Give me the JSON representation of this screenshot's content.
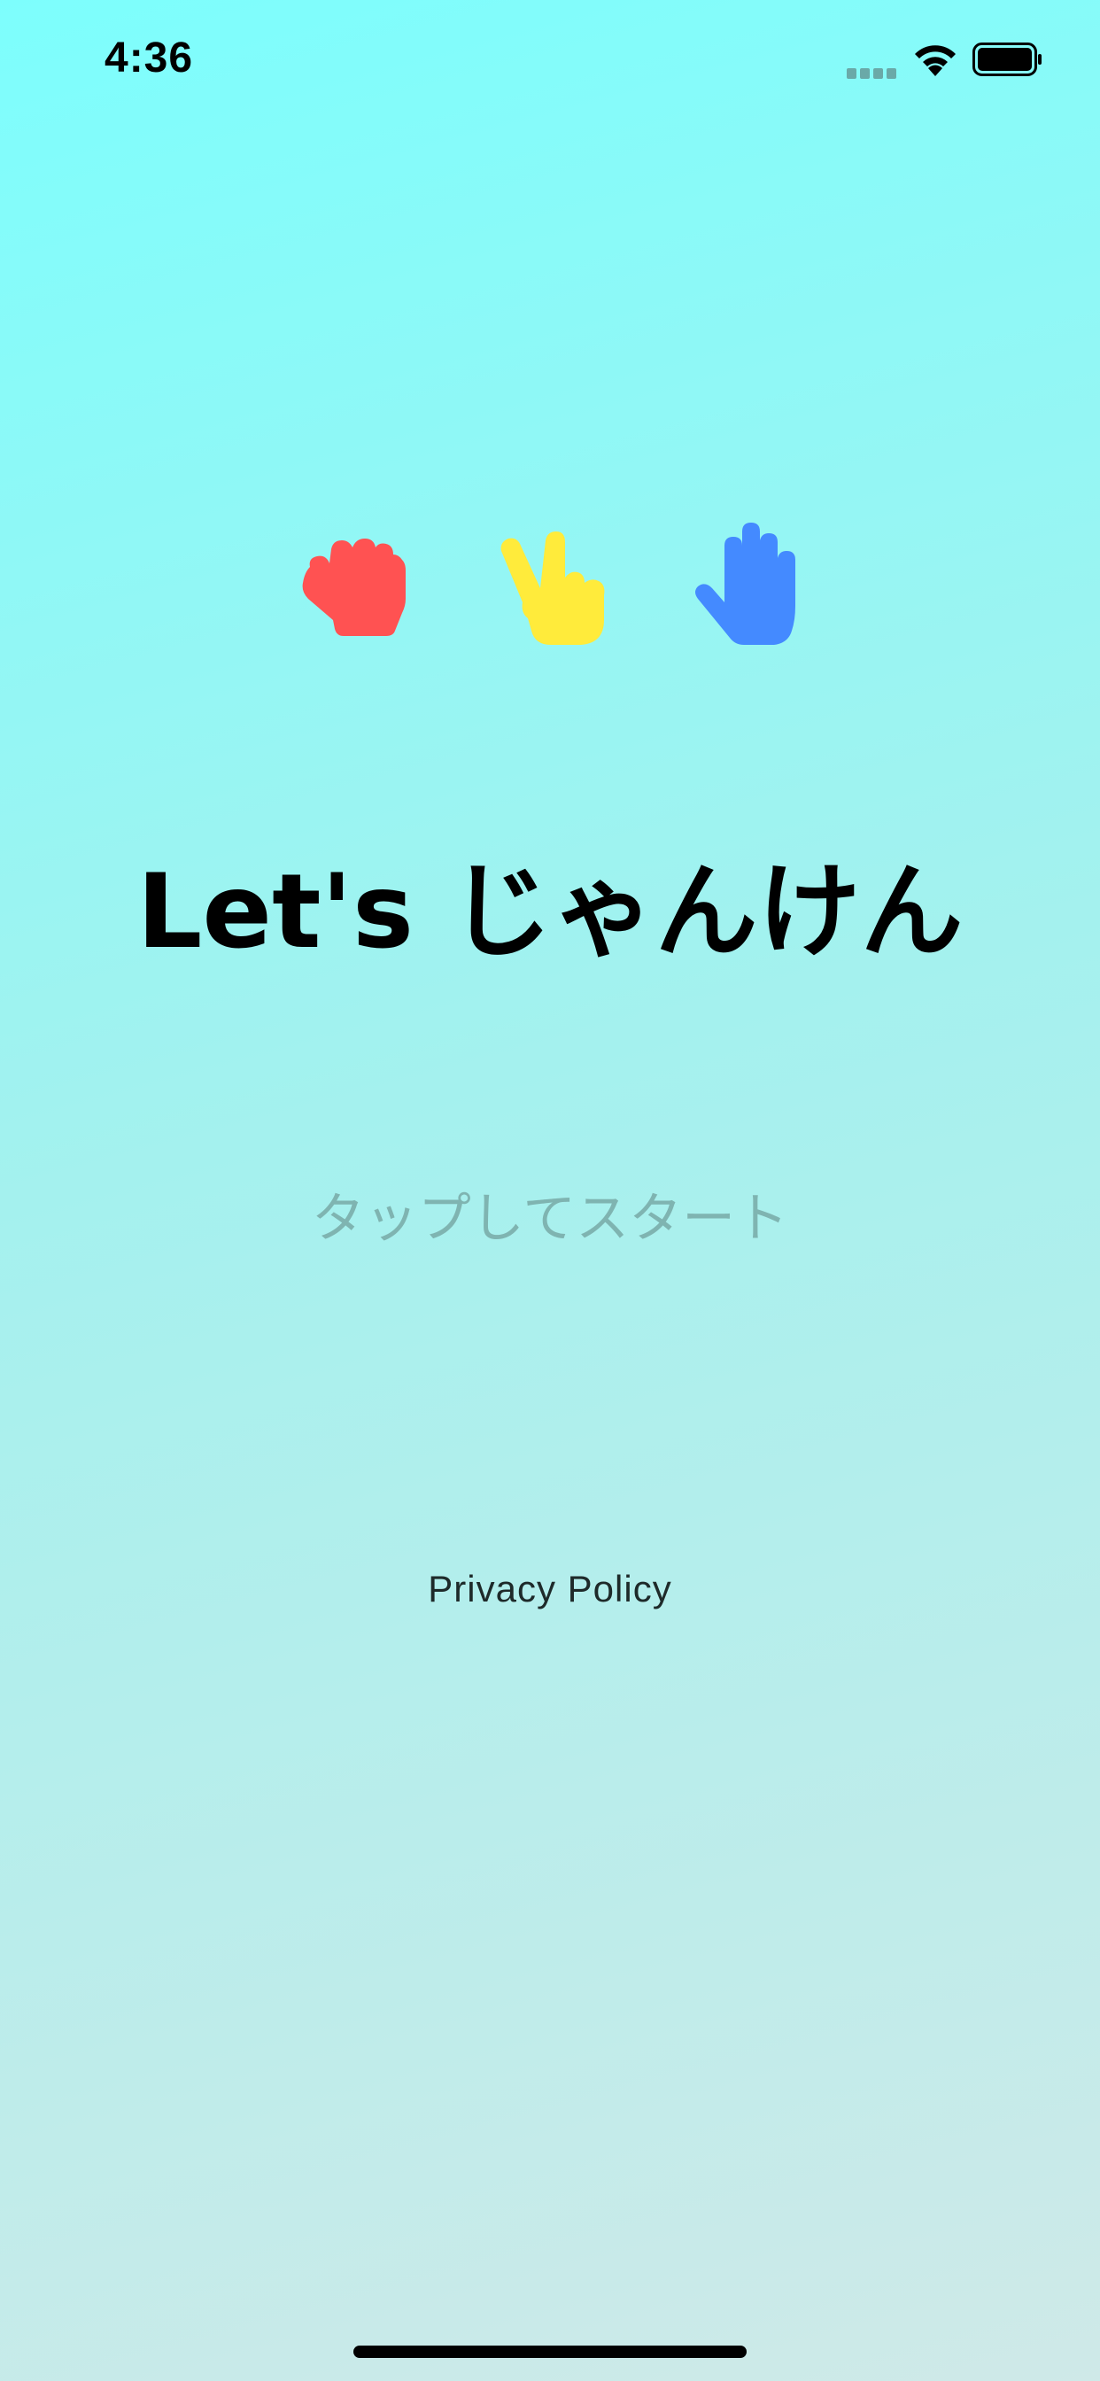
{
  "status_bar": {
    "time": "4:36",
    "icons": [
      "cellular-signal-icon",
      "wifi-icon",
      "battery-icon"
    ]
  },
  "hands": [
    {
      "name": "rock",
      "icon": "rock-hand-icon",
      "color": "#ff5252"
    },
    {
      "name": "scissors",
      "icon": "scissors-hand-icon",
      "color": "#ffeb3b"
    },
    {
      "name": "paper",
      "icon": "paper-hand-icon",
      "color": "#448aff"
    }
  ],
  "title": "Let's じゃんけん",
  "tap_to_start": "タップしてスタート",
  "privacy_policy": "Privacy Policy",
  "colors": {
    "background_top": "#7dfefd",
    "background_bottom": "#cfe9e8",
    "title": "#000000",
    "tap_text": "#7fb4b1"
  }
}
